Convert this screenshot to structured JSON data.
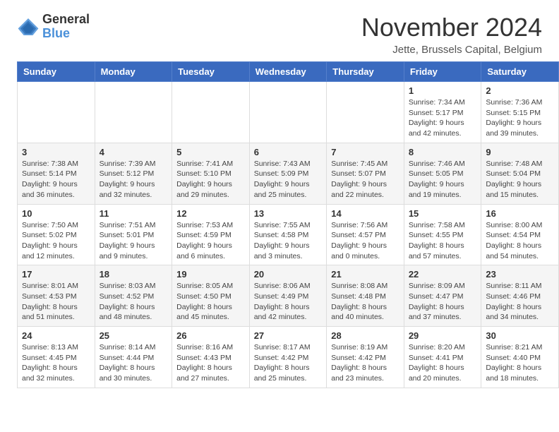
{
  "header": {
    "logo_general": "General",
    "logo_blue": "Blue",
    "month_title": "November 2024",
    "location": "Jette, Brussels Capital, Belgium"
  },
  "weekdays": [
    "Sunday",
    "Monday",
    "Tuesday",
    "Wednesday",
    "Thursday",
    "Friday",
    "Saturday"
  ],
  "weeks": [
    [
      {
        "day": "",
        "info": ""
      },
      {
        "day": "",
        "info": ""
      },
      {
        "day": "",
        "info": ""
      },
      {
        "day": "",
        "info": ""
      },
      {
        "day": "",
        "info": ""
      },
      {
        "day": "1",
        "info": "Sunrise: 7:34 AM\nSunset: 5:17 PM\nDaylight: 9 hours and 42 minutes."
      },
      {
        "day": "2",
        "info": "Sunrise: 7:36 AM\nSunset: 5:15 PM\nDaylight: 9 hours and 39 minutes."
      }
    ],
    [
      {
        "day": "3",
        "info": "Sunrise: 7:38 AM\nSunset: 5:14 PM\nDaylight: 9 hours and 36 minutes."
      },
      {
        "day": "4",
        "info": "Sunrise: 7:39 AM\nSunset: 5:12 PM\nDaylight: 9 hours and 32 minutes."
      },
      {
        "day": "5",
        "info": "Sunrise: 7:41 AM\nSunset: 5:10 PM\nDaylight: 9 hours and 29 minutes."
      },
      {
        "day": "6",
        "info": "Sunrise: 7:43 AM\nSunset: 5:09 PM\nDaylight: 9 hours and 25 minutes."
      },
      {
        "day": "7",
        "info": "Sunrise: 7:45 AM\nSunset: 5:07 PM\nDaylight: 9 hours and 22 minutes."
      },
      {
        "day": "8",
        "info": "Sunrise: 7:46 AM\nSunset: 5:05 PM\nDaylight: 9 hours and 19 minutes."
      },
      {
        "day": "9",
        "info": "Sunrise: 7:48 AM\nSunset: 5:04 PM\nDaylight: 9 hours and 15 minutes."
      }
    ],
    [
      {
        "day": "10",
        "info": "Sunrise: 7:50 AM\nSunset: 5:02 PM\nDaylight: 9 hours and 12 minutes."
      },
      {
        "day": "11",
        "info": "Sunrise: 7:51 AM\nSunset: 5:01 PM\nDaylight: 9 hours and 9 minutes."
      },
      {
        "day": "12",
        "info": "Sunrise: 7:53 AM\nSunset: 4:59 PM\nDaylight: 9 hours and 6 minutes."
      },
      {
        "day": "13",
        "info": "Sunrise: 7:55 AM\nSunset: 4:58 PM\nDaylight: 9 hours and 3 minutes."
      },
      {
        "day": "14",
        "info": "Sunrise: 7:56 AM\nSunset: 4:57 PM\nDaylight: 9 hours and 0 minutes."
      },
      {
        "day": "15",
        "info": "Sunrise: 7:58 AM\nSunset: 4:55 PM\nDaylight: 8 hours and 57 minutes."
      },
      {
        "day": "16",
        "info": "Sunrise: 8:00 AM\nSunset: 4:54 PM\nDaylight: 8 hours and 54 minutes."
      }
    ],
    [
      {
        "day": "17",
        "info": "Sunrise: 8:01 AM\nSunset: 4:53 PM\nDaylight: 8 hours and 51 minutes."
      },
      {
        "day": "18",
        "info": "Sunrise: 8:03 AM\nSunset: 4:52 PM\nDaylight: 8 hours and 48 minutes."
      },
      {
        "day": "19",
        "info": "Sunrise: 8:05 AM\nSunset: 4:50 PM\nDaylight: 8 hours and 45 minutes."
      },
      {
        "day": "20",
        "info": "Sunrise: 8:06 AM\nSunset: 4:49 PM\nDaylight: 8 hours and 42 minutes."
      },
      {
        "day": "21",
        "info": "Sunrise: 8:08 AM\nSunset: 4:48 PM\nDaylight: 8 hours and 40 minutes."
      },
      {
        "day": "22",
        "info": "Sunrise: 8:09 AM\nSunset: 4:47 PM\nDaylight: 8 hours and 37 minutes."
      },
      {
        "day": "23",
        "info": "Sunrise: 8:11 AM\nSunset: 4:46 PM\nDaylight: 8 hours and 34 minutes."
      }
    ],
    [
      {
        "day": "24",
        "info": "Sunrise: 8:13 AM\nSunset: 4:45 PM\nDaylight: 8 hours and 32 minutes."
      },
      {
        "day": "25",
        "info": "Sunrise: 8:14 AM\nSunset: 4:44 PM\nDaylight: 8 hours and 30 minutes."
      },
      {
        "day": "26",
        "info": "Sunrise: 8:16 AM\nSunset: 4:43 PM\nDaylight: 8 hours and 27 minutes."
      },
      {
        "day": "27",
        "info": "Sunrise: 8:17 AM\nSunset: 4:42 PM\nDaylight: 8 hours and 25 minutes."
      },
      {
        "day": "28",
        "info": "Sunrise: 8:19 AM\nSunset: 4:42 PM\nDaylight: 8 hours and 23 minutes."
      },
      {
        "day": "29",
        "info": "Sunrise: 8:20 AM\nSunset: 4:41 PM\nDaylight: 8 hours and 20 minutes."
      },
      {
        "day": "30",
        "info": "Sunrise: 8:21 AM\nSunset: 4:40 PM\nDaylight: 8 hours and 18 minutes."
      }
    ]
  ]
}
